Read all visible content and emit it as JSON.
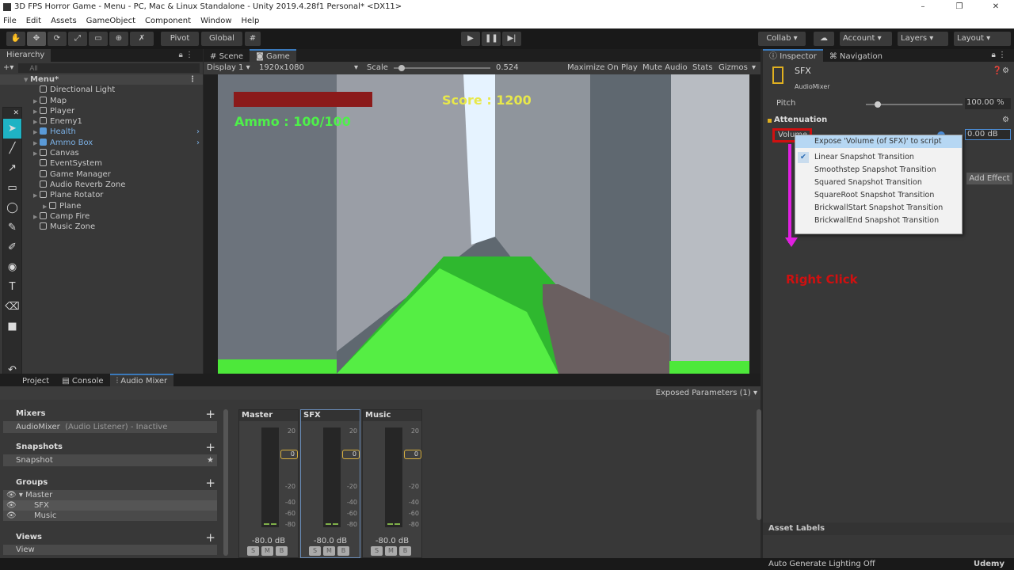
{
  "window": {
    "title": "3D FPS Horror Game - Menu - PC, Mac & Linux Standalone - Unity 2019.4.28f1 Personal* <DX11>",
    "minimize": "–",
    "maximize": "❐",
    "close": "✕"
  },
  "menu": [
    "File",
    "Edit",
    "Assets",
    "GameObject",
    "Component",
    "Window",
    "Help"
  ],
  "toolbar": {
    "pivot": "Pivot",
    "global": "Global",
    "collab": "Collab ▾",
    "account": "Account",
    "layers": "Layers",
    "layout": "Layout",
    "play": "▶",
    "pause": "❚❚",
    "step": "▶|",
    "tools": [
      "✋",
      "✥",
      "⟳",
      "⤢",
      "▭",
      "⊕",
      "✗"
    ]
  },
  "hierarchy": {
    "title": "Hierarchy",
    "search_placeholder": "All",
    "scene": "Menu*",
    "items": [
      {
        "label": "Directional Light",
        "arrow": false,
        "prefab": false,
        "indent": 1
      },
      {
        "label": "Map",
        "arrow": true,
        "prefab": false,
        "indent": 1
      },
      {
        "label": "Player",
        "arrow": true,
        "prefab": false,
        "indent": 1
      },
      {
        "label": "Enemy1",
        "arrow": true,
        "prefab": false,
        "indent": 1
      },
      {
        "label": "Health",
        "arrow": true,
        "prefab": true,
        "indent": 1
      },
      {
        "label": "Ammo Box",
        "arrow": true,
        "prefab": true,
        "indent": 1
      },
      {
        "label": "Canvas",
        "arrow": true,
        "prefab": false,
        "indent": 1
      },
      {
        "label": "EventSystem",
        "arrow": false,
        "prefab": false,
        "indent": 1
      },
      {
        "label": "Game Manager",
        "arrow": false,
        "prefab": false,
        "indent": 1
      },
      {
        "label": "Audio Reverb Zone",
        "arrow": false,
        "prefab": false,
        "indent": 1
      },
      {
        "label": "Plane Rotator",
        "arrow": true,
        "prefab": false,
        "indent": 1
      },
      {
        "label": "Plane",
        "arrow": true,
        "prefab": false,
        "indent": 2
      },
      {
        "label": "Camp Fire",
        "arrow": true,
        "prefab": false,
        "indent": 1
      },
      {
        "label": "Music Zone",
        "arrow": false,
        "prefab": false,
        "indent": 1
      }
    ]
  },
  "game": {
    "tab_scene": "Scene",
    "tab_game": "Game",
    "display": "Display 1",
    "resolution": "1920x1080",
    "scale_label": "Scale",
    "scale_value": "0.524",
    "scale_fraction": 0.05,
    "maximize": "Maximize On Play",
    "mute": "Mute Audio",
    "stats": "Stats",
    "gizmos": "Gizmos",
    "score": "Score : 1200",
    "ammo": "Ammo : 100/100"
  },
  "inspector": {
    "tab": "Inspector",
    "tab_nav": "Navigation",
    "name": "SFX",
    "type": "AudioMixer",
    "pitch_label": "Pitch",
    "pitch_value": "100.00 %",
    "pitch_fraction": 0.1,
    "section": "Attenuation",
    "volume_label": "Volume",
    "volume_value": "0.00 dB",
    "add_effect": "Add Effect",
    "asset_labels": "Asset Labels",
    "annotation": "Right Click"
  },
  "context_menu": {
    "items": [
      "Expose 'Volume (of SFX)' to script",
      "Linear Snapshot Transition",
      "Smoothstep Snapshot Transition",
      "Squared Snapshot Transition",
      "SquareRoot Snapshot Transition",
      "BrickwallStart Snapshot Transition",
      "BrickwallEnd Snapshot Transition"
    ],
    "highlighted": 0,
    "checked": 1
  },
  "bottom": {
    "tabs": [
      "Project",
      "Console",
      "Audio Mixer"
    ],
    "exposed": "Exposed Parameters (1) ▾",
    "mixers_title": "Mixers",
    "mixer_name": "AudioMixer",
    "mixer_status": "(Audio Listener) - Inactive",
    "snapshots_title": "Snapshots",
    "snapshot": "Snapshot",
    "groups_title": "Groups",
    "groups": [
      "Master",
      "SFX",
      "Music"
    ],
    "views_title": "Views",
    "view": "View",
    "strips": [
      {
        "name": "Master",
        "db": "-80.0 dB",
        "att": "0"
      },
      {
        "name": "SFX",
        "db": "-80.0 dB",
        "att": "0"
      },
      {
        "name": "Music",
        "db": "-80.0 dB",
        "att": "0"
      }
    ],
    "scale": [
      "20",
      "-20",
      "-40",
      "-60",
      "-80"
    ],
    "smb": [
      "S",
      "M",
      "B"
    ]
  },
  "status": {
    "text": "Auto Generate Lighting Off",
    "brand": "Udemy"
  }
}
